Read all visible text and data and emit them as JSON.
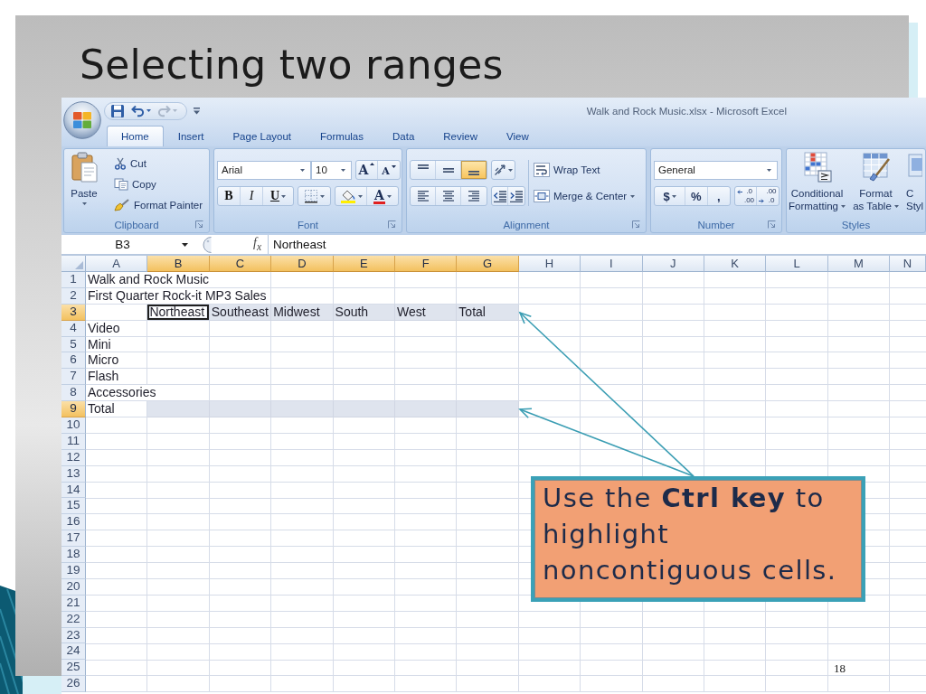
{
  "slide": {
    "title": "Selecting two ranges",
    "callout": "Use the **Ctrl key** to highlight noncontiguous cells.",
    "page_number": "18"
  },
  "excel": {
    "title": "Walk and Rock Music.xlsx - Microsoft Excel",
    "quick_access": [
      {
        "kind": "save",
        "disabled": false
      },
      {
        "kind": "undo",
        "disabled": false
      },
      {
        "kind": "redo",
        "disabled": true
      }
    ],
    "tabs": [
      {
        "label": "Home",
        "selected": true
      },
      {
        "label": "Insert",
        "selected": false
      },
      {
        "label": "Page Layout",
        "selected": false
      },
      {
        "label": "Formulas",
        "selected": false
      },
      {
        "label": "Data",
        "selected": false
      },
      {
        "label": "Review",
        "selected": false
      },
      {
        "label": "View",
        "selected": false
      }
    ],
    "ribbon": {
      "clipboard": {
        "label": "Clipboard",
        "paste": "Paste",
        "cut": "Cut",
        "copy": "Copy",
        "format_painter": "Format Painter"
      },
      "font": {
        "label": "Font",
        "font_name": "Arial",
        "font_size": "10",
        "grow": "A",
        "shrink": "A",
        "bold": "B",
        "italic": "I",
        "underline": "U",
        "font_color": "A"
      },
      "alignment": {
        "label": "Alignment",
        "vertical": [
          {
            "kind": "top",
            "on": false
          },
          {
            "kind": "middle",
            "on": false
          },
          {
            "kind": "bottom",
            "on": true
          }
        ],
        "horizontal": [
          {
            "kind": "left",
            "on": false
          },
          {
            "kind": "center",
            "on": false
          },
          {
            "kind": "right",
            "on": false
          }
        ],
        "wrap_text": "Wrap Text",
        "merge_center": "Merge & Center"
      },
      "number": {
        "label": "Number",
        "format": "General",
        "currency": "$",
        "percent": "%",
        "comma": ",",
        "increase_decimal": [
          ".0",
          ".00"
        ],
        "decrease_decimal": [
          ".00",
          ".0"
        ]
      },
      "styles": {
        "label": "Styles",
        "buttons": [
          {
            "kind": "conditional",
            "lines": [
              "Conditional",
              "Formatting"
            ],
            "dropdown": true
          },
          {
            "kind": "table",
            "lines": [
              "Format",
              "as Table"
            ],
            "dropdown": true
          },
          {
            "kind": "cell",
            "lines": [
              "C",
              "Styl"
            ],
            "dropdown": false
          }
        ]
      }
    },
    "formula_bar": {
      "name_box": "B3",
      "function_label": "f$_{x}$",
      "value": "Northeast"
    },
    "grid": {
      "columns": [
        {
          "label": "A",
          "selected": false
        },
        {
          "label": "B",
          "selected": true
        },
        {
          "label": "C",
          "selected": true
        },
        {
          "label": "D",
          "selected": true
        },
        {
          "label": "E",
          "selected": true
        },
        {
          "label": "F",
          "selected": true
        },
        {
          "label": "G",
          "selected": true
        },
        {
          "label": "H",
          "selected": false
        },
        {
          "label": "I",
          "selected": false
        },
        {
          "label": "J",
          "selected": false
        },
        {
          "label": "K",
          "selected": false
        },
        {
          "label": "L",
          "selected": false
        },
        {
          "label": "M",
          "selected": false
        },
        {
          "label": "N",
          "selected": false
        }
      ],
      "rows": [
        {
          "number": "1",
          "selected": false,
          "label": {
            "text": "Walk and Rock Music",
            "selected": false,
            "active": false
          }
        },
        {
          "number": "2",
          "selected": false,
          "label": {
            "text": "First Quarter Rock-it MP3 Sales",
            "selected": false,
            "active": false
          }
        },
        {
          "number": "3",
          "selected": true,
          "cells": [
            {
              "text": "Northeast",
              "selected": true,
              "active": true
            },
            {
              "text": "Southeast",
              "selected": true,
              "active": false
            },
            {
              "text": "Midwest",
              "selected": true,
              "active": false
            },
            {
              "text": "South",
              "selected": true,
              "active": false
            },
            {
              "text": "West",
              "selected": true,
              "active": false
            },
            {
              "text": "Total",
              "selected": true,
              "active": false
            }
          ]
        },
        {
          "number": "4",
          "selected": false,
          "label": {
            "text": "Video",
            "selected": false,
            "active": false
          }
        },
        {
          "number": "5",
          "selected": false,
          "label": {
            "text": "Mini",
            "selected": false,
            "active": false
          }
        },
        {
          "number": "6",
          "selected": false,
          "label": {
            "text": "Micro",
            "selected": false,
            "active": false
          }
        },
        {
          "number": "7",
          "selected": false,
          "label": {
            "text": "Flash",
            "selected": false,
            "active": false
          }
        },
        {
          "number": "8",
          "selected": false,
          "label": {
            "text": "Accessories",
            "selected": false,
            "active": false
          }
        },
        {
          "number": "9",
          "selected": true,
          "label": {
            "text": "Total",
            "selected": false,
            "active": false
          },
          "cells": [
            {
              "selected": true,
              "active": false
            },
            {
              "selected": true,
              "active": false
            },
            {
              "selected": true,
              "active": false
            },
            {
              "selected": true,
              "active": false
            },
            {
              "selected": true,
              "active": false
            },
            {
              "selected": true,
              "active": false
            }
          ]
        },
        {
          "number": "10",
          "selected": false
        },
        {
          "number": "11",
          "selected": false
        },
        {
          "number": "12",
          "selected": false
        },
        {
          "number": "13",
          "selected": false
        },
        {
          "number": "14",
          "selected": false
        },
        {
          "number": "15",
          "selected": false
        },
        {
          "number": "16",
          "selected": false
        },
        {
          "number": "17",
          "selected": false
        },
        {
          "number": "18",
          "selected": false
        },
        {
          "number": "19",
          "selected": false
        },
        {
          "number": "20",
          "selected": false
        },
        {
          "number": "21",
          "selected": false
        },
        {
          "number": "22",
          "selected": false
        },
        {
          "number": "23",
          "selected": false
        },
        {
          "number": "24",
          "selected": false
        },
        {
          "number": "25",
          "selected": false
        },
        {
          "number": "26",
          "selected": false
        }
      ]
    }
  }
}
